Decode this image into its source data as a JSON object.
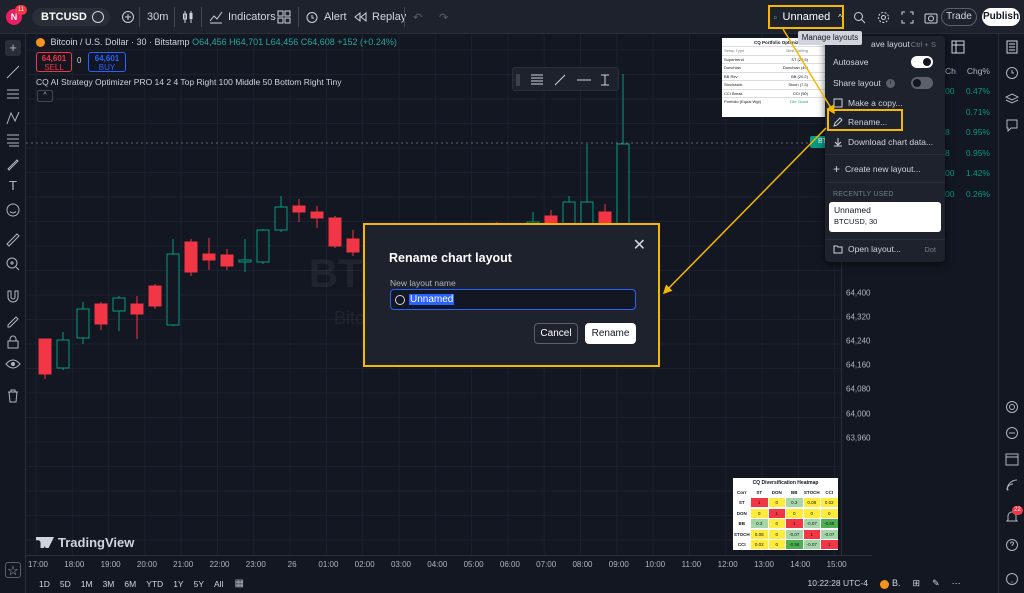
{
  "topbar": {
    "logo_letter": "N",
    "notification_count": "11",
    "symbol": "BTCUSD",
    "interval": "30m",
    "indicators_label": "Indicators",
    "alert_label": "Alert",
    "replay_label": "Replay",
    "layout_name": "Unnamed",
    "trade_label": "Trade",
    "publish_label": "Publish"
  },
  "legend": {
    "title": "Bitcoin / U.S. Dollar · 30 · Bitstamp",
    "o": "O64,456",
    "h": "H64,701",
    "l": "L64,456",
    "c": "C64,608",
    "chg": "+152 (+0.24%)",
    "sell_price": "64,601",
    "sell_label": "SELL",
    "mid_value": "0",
    "buy_price": "64,601",
    "buy_label": "BUY",
    "strategy": "CQ AI Strategy Optimizer PRO 14 2 4 Top Right 100 Middle 50 Bottom Right Tiny"
  },
  "watermark": {
    "symbol": "BTC",
    "name": "Bitc"
  },
  "tv_logo": "TradingView",
  "price_axis": {
    "labels": [
      "64,400",
      "64,320",
      "64,240",
      "64,160",
      "64,080",
      "64,000",
      "63,960"
    ],
    "btc_tag": "BTC"
  },
  "time_axis": {
    "labels": [
      "17:00",
      "18:00",
      "19:00",
      "20:00",
      "21:00",
      "22:00",
      "23:00",
      "26",
      "01:00",
      "02:00",
      "03:00",
      "04:00",
      "05:00",
      "06:00",
      "07:00",
      "08:00",
      "09:00",
      "10:00",
      "11:00",
      "12:00",
      "13:00",
      "14:00",
      "15:00"
    ]
  },
  "bottom_bar": {
    "ranges": [
      "1D",
      "5D",
      "1M",
      "3M",
      "6M",
      "YTD",
      "1Y",
      "5Y",
      "All"
    ],
    "time": "10:22:28 UTC-4"
  },
  "portfolio_table": {
    "title": "CQ Portfolio Optimiz...",
    "header": [
      "Setup Type",
      "Best Setting",
      "Net"
    ],
    "rows": [
      [
        "Supertrend",
        "ST (20,5)",
        "+0.3"
      ],
      [
        "Donchian",
        "Donchian (40)",
        "+0.2"
      ],
      [
        "BB Rev",
        "BB (20,2)",
        "+0.1"
      ],
      [
        "Stochastic",
        "Stoch (7,3)",
        "-0.2"
      ],
      [
        "CCI Break",
        "CCI (50)",
        "-0."
      ],
      [
        "Portfolio (Equal Wgt)",
        "Div: Good",
        "+0."
      ]
    ]
  },
  "heatmap": {
    "title": "CQ Diversification Heatmap",
    "columns": [
      "Corr",
      "ST",
      "DON",
      "BB",
      "STOCH",
      "CCI"
    ],
    "rows": [
      [
        "ST",
        "1",
        "0",
        "0.3",
        "0.08",
        "0.02"
      ],
      [
        "DON",
        "0",
        "1",
        "0",
        "0",
        "0"
      ],
      [
        "BB",
        "0.3",
        "0",
        "1",
        "-0.07",
        "-0.58"
      ],
      [
        "STOCH",
        "0.08",
        "0",
        "-0.07",
        "1",
        "-0.07"
      ],
      [
        "CCI",
        "0.02",
        "0",
        "-0.58",
        "-0.07",
        "1"
      ]
    ],
    "colors": {
      "one": "#f23645",
      "neutral": "#ffeb3b",
      "positive": "#a5d6a7",
      "strong": "#4caf50",
      "negative": "#66bb6a"
    }
  },
  "watchlist": {
    "header": "Chg%",
    "header_left": "Ch",
    "rows": [
      {
        "left": "00",
        "value": "0.47%"
      },
      {
        "left": "",
        "value": "0.71%"
      },
      {
        "left": "8",
        "value": "0.95%"
      },
      {
        "left": "8",
        "value": "0.95%"
      },
      {
        "left": "00",
        "value": "1.42%"
      },
      {
        "left": "00",
        "value": "0.26%"
      }
    ]
  },
  "right_tools_badge": "22",
  "layout_menu": {
    "tooltip": "Manage layouts",
    "save_label": "ave layout",
    "save_shortcut": "Ctrl + S",
    "autosave_label": "Autosave",
    "autosave_on": true,
    "share_label": "Share layout",
    "share_on": false,
    "copy_label": "Make a copy...",
    "rename_label": "Rename...",
    "download_label": "Download chart data...",
    "create_label": "Create new layout...",
    "recent_header": "RECENTLY USED",
    "recent_name": "Unnamed",
    "recent_detail": "BTCUSD, 30",
    "open_label": "Open layout...",
    "open_shortcut": "Dot"
  },
  "rename_dialog": {
    "title": "Rename chart layout",
    "field_label": "New layout name",
    "field_value": "Unnamed",
    "cancel_label": "Cancel",
    "rename_label": "Rename"
  },
  "bottom_right": {
    "symbol": "B."
  },
  "colors": {
    "accent": "#2962ff",
    "highlight": "#f5b800",
    "up": "#089981",
    "down": "#f23645",
    "bg": "#131722"
  }
}
